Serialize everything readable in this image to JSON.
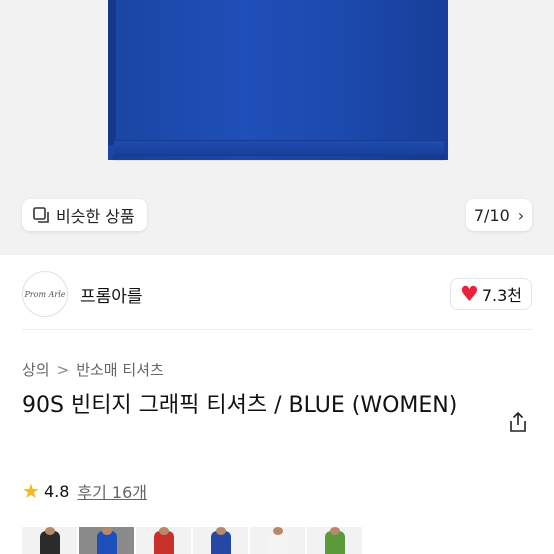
{
  "gallery": {
    "similar_label": "비슷한 상품",
    "pager": "7/10",
    "pager_next_icon": "chevron-right-icon",
    "shirt_color": "#1f4fb8"
  },
  "shop": {
    "logo_text": "Prom Arle",
    "name": "프롬아를"
  },
  "like": {
    "count": "7.3천",
    "heart_color": "#e8223a"
  },
  "breadcrumb": {
    "level1": "상의",
    "separator": ">",
    "level2": "반소매 티셔츠"
  },
  "product": {
    "title": "90S 빈티지 그래픽 티셔츠 / BLUE (WOMEN)"
  },
  "rating": {
    "score": "4.8",
    "reviews": "후기 16개"
  },
  "thumbnails": [
    {
      "color": "#2b2b2b",
      "bg": "#f2f2f2"
    },
    {
      "color": "#1f4fb8",
      "bg": "#8a8a8a"
    },
    {
      "color": "#c8312a",
      "bg": "#f2f2f2"
    },
    {
      "color": "#2648a5",
      "bg": "#f2f2f2"
    },
    {
      "color": "#f4f4f4",
      "bg": "#f2f2f2"
    },
    {
      "color": "#5a9a3a",
      "bg": "#f2f2f2"
    }
  ]
}
